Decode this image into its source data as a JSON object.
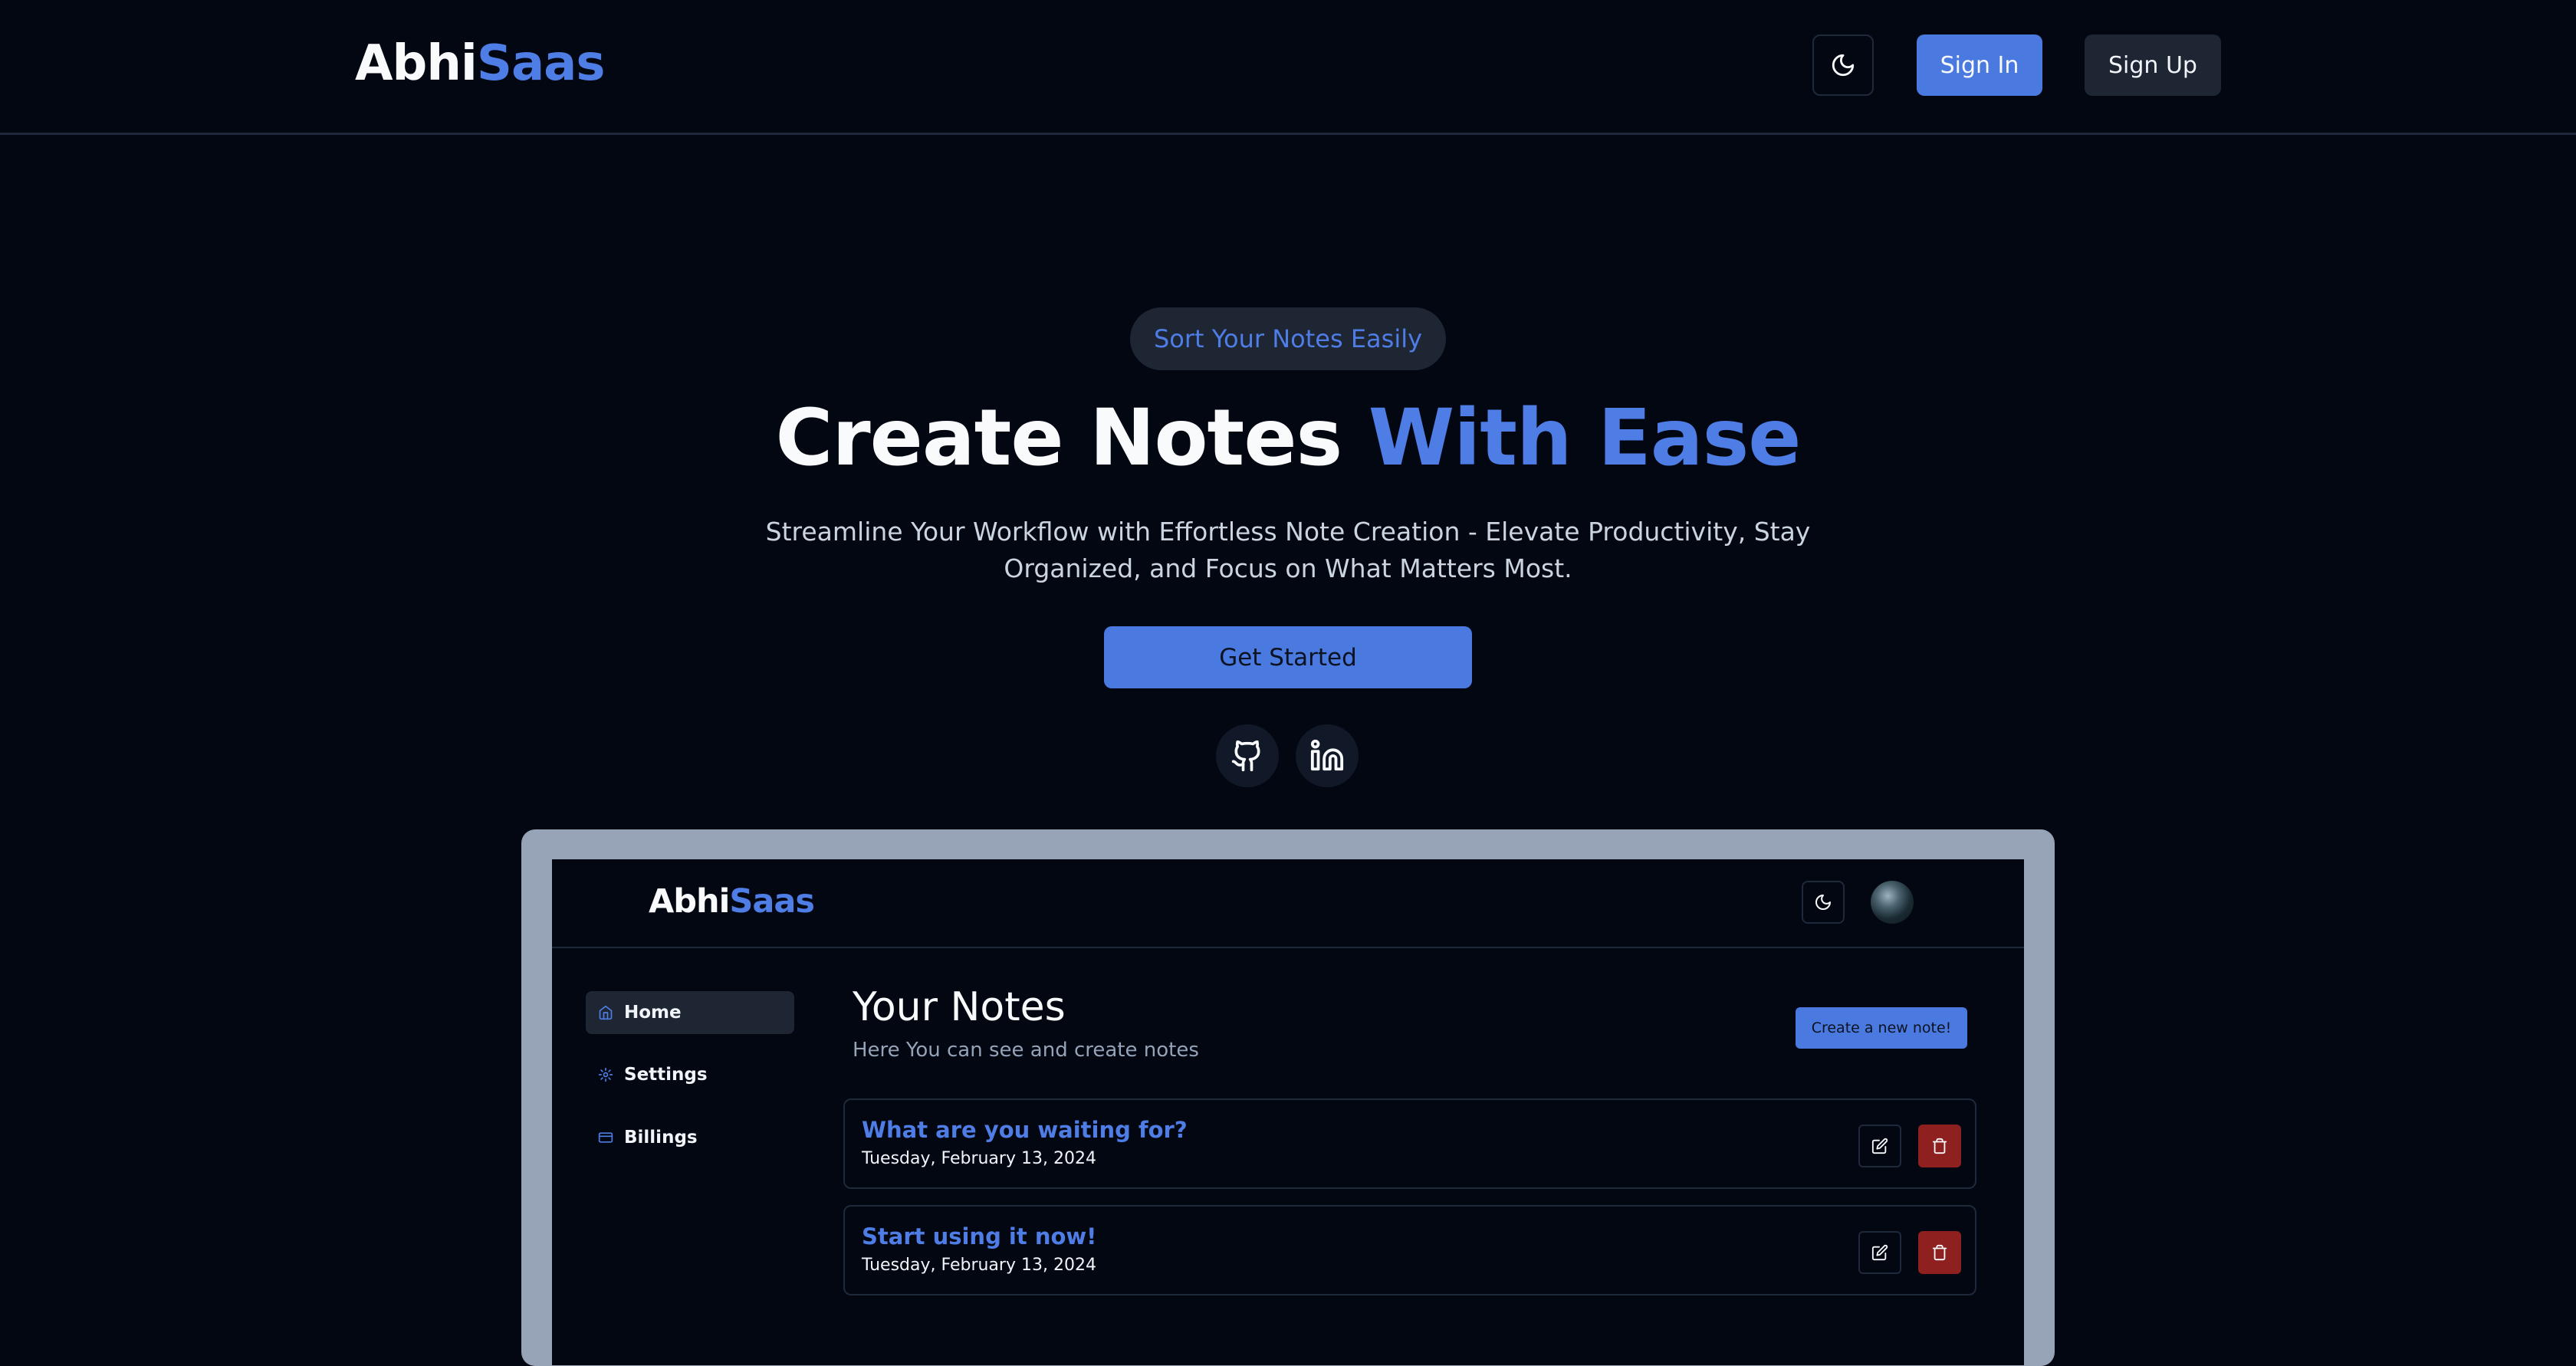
{
  "brand": {
    "name_main": "Abhi",
    "name_accent": "Saas"
  },
  "colors": {
    "accent": "#4f7de6",
    "background": "#030712",
    "danger": "#8f2020",
    "frame": "#97a3b6"
  },
  "header": {
    "theme_icon": "moon-icon",
    "sign_in_label": "Sign In",
    "sign_up_label": "Sign Up"
  },
  "hero": {
    "badge": "Sort Your Notes Easily",
    "title_main": "Create Notes ",
    "title_accent": "With Ease",
    "subtitle": "Streamline Your Workflow with Effortless Note Creation - Elevate Productivity, Stay Organized, and Focus on What Matters Most.",
    "cta_label": "Get Started",
    "social_icons": [
      "github-icon",
      "linkedin-icon"
    ]
  },
  "preview": {
    "brand": {
      "name_main": "Abhi",
      "name_accent": "Saas"
    },
    "sidebar": {
      "items": [
        {
          "label": "Home",
          "icon": "home-icon",
          "active": true
        },
        {
          "label": "Settings",
          "icon": "gear-icon",
          "active": false
        },
        {
          "label": "Billings",
          "icon": "credit-card-icon",
          "active": false
        }
      ]
    },
    "main": {
      "title": "Your Notes",
      "subtitle": "Here You can see and create notes",
      "create_label": "Create a new note!",
      "notes": [
        {
          "title": "What are you waiting for?",
          "date": "Tuesday, February 13, 2024"
        },
        {
          "title": "Start using it now!",
          "date": "Tuesday, February 13, 2024"
        }
      ]
    }
  }
}
